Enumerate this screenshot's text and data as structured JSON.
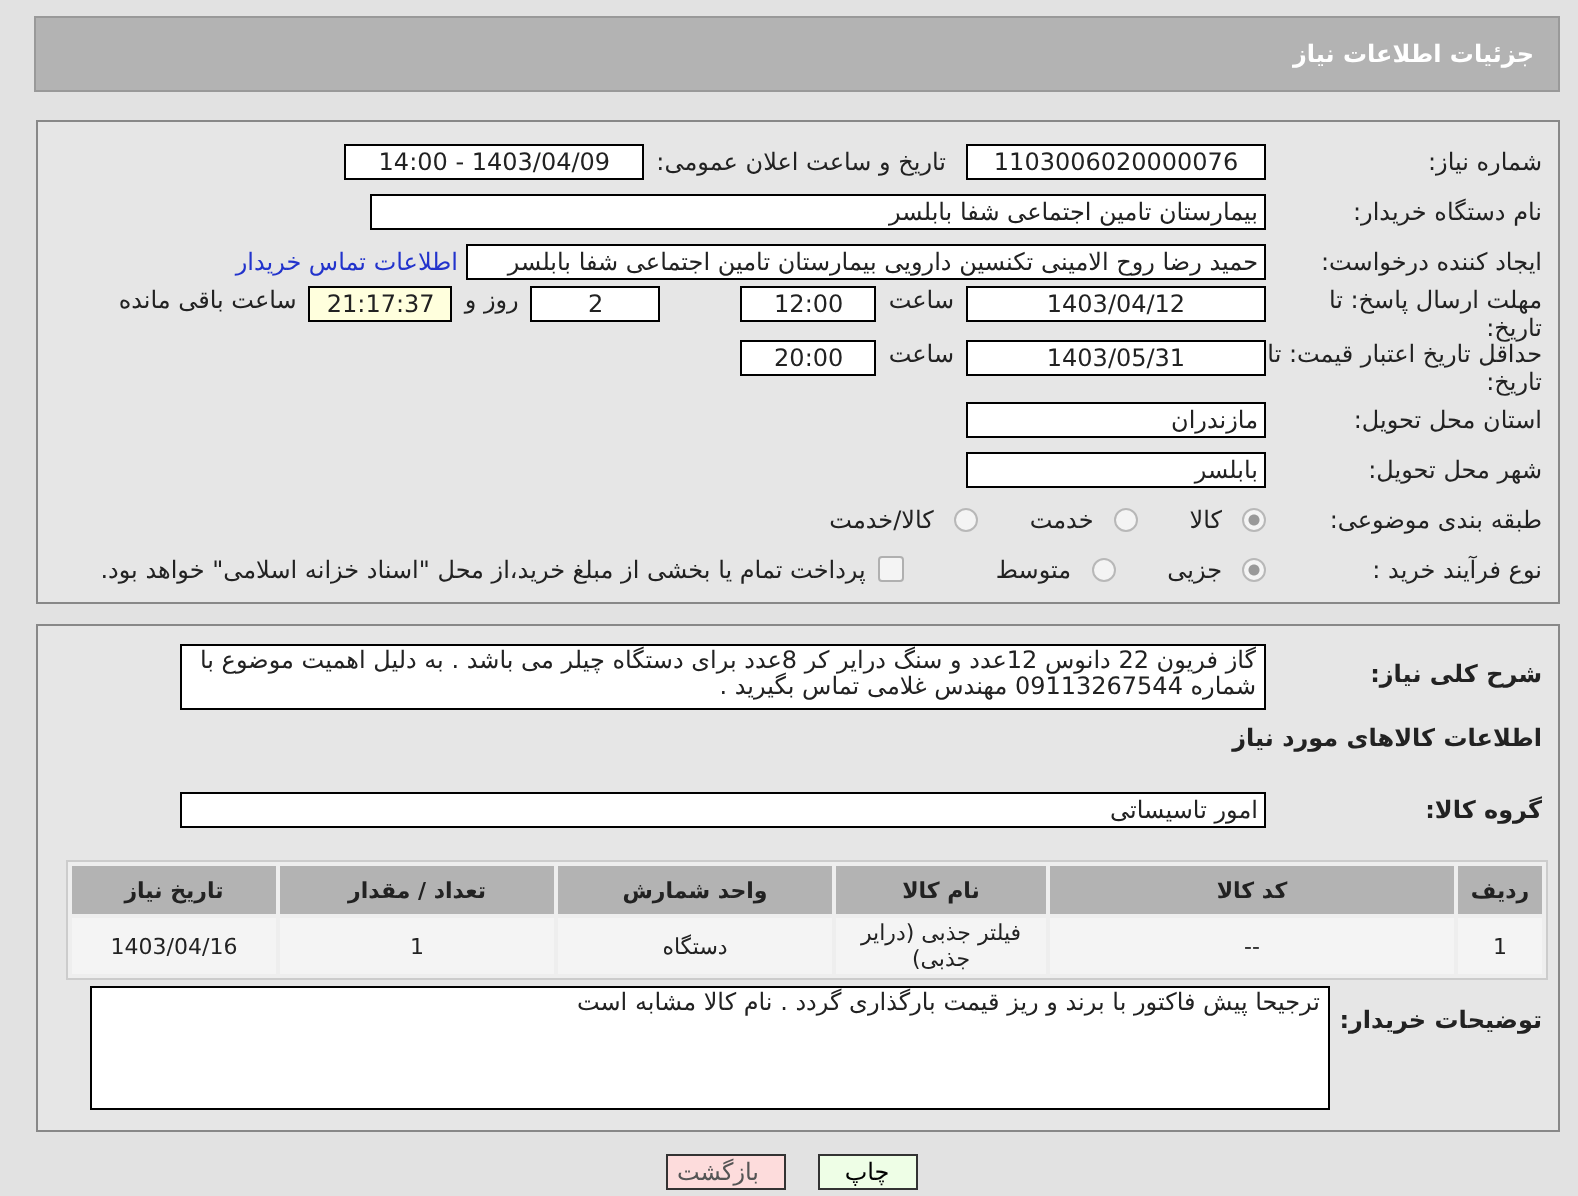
{
  "header": {
    "title": "جزئیات اطلاعات نیاز"
  },
  "need_number": {
    "label": "شماره نیاز:",
    "value": "1103006020000076"
  },
  "announce": {
    "label": "تاریخ و ساعت اعلان عمومی:",
    "value": "1403/04/09 - 14:00"
  },
  "buyer_org": {
    "label": "نام دستگاه خریدار:",
    "value": "بیمارستان تامین اجتماعی شفا بابلسر"
  },
  "requester": {
    "label": "ایجاد کننده درخواست:",
    "value": "حمید رضا روح الامینی تکنسین دارویی بیمارستان تامین اجتماعی شفا بابلسر",
    "link": "اطلاعات تماس خریدار"
  },
  "reply_deadline": {
    "label": "مهلت ارسال پاسخ: تا تاریخ:",
    "date": "1403/04/12",
    "time_label": "ساعت",
    "time": "12:00",
    "days": "2",
    "days_label": "روز و",
    "remaining": "21:17:37",
    "remaining_label": "ساعت باقی مانده"
  },
  "price_validity": {
    "label": "حداقل تاریخ اعتبار قیمت: تا تاریخ:",
    "date": "1403/05/31",
    "time_label": "ساعت",
    "time": "20:00"
  },
  "province": {
    "label": "استان محل تحویل:",
    "value": "مازندران"
  },
  "city": {
    "label": "شهر محل تحویل:",
    "value": "بابلسر"
  },
  "category": {
    "label": "طبقه بندی موضوعی:",
    "options": [
      {
        "label": "کالا",
        "selected": true
      },
      {
        "label": "خدمت",
        "selected": false
      },
      {
        "label": "کالا/خدمت",
        "selected": false
      }
    ]
  },
  "process": {
    "label": "نوع فرآیند خرید :",
    "options": [
      {
        "label": "جزیی",
        "selected": true
      },
      {
        "label": "متوسط",
        "selected": false
      }
    ],
    "payment": {
      "label": "پرداخت تمام یا بخشی از مبلغ خرید،از محل \"اسناد خزانه اسلامی\" خواهد بود.",
      "checked": false
    }
  },
  "description": {
    "label": "شرح کلی نیاز:",
    "value": "گاز فریون 22 دانوس  12عدد و سنگ درایر کر 8عدد  برای دستگاه چیلر می باشد . به دلیل اهمیت موضوع با شماره 09113267544 مهندس غلامی تماس بگیرید ."
  },
  "goods_title": "اطلاعات کالاهای مورد نیاز",
  "goods_group": {
    "label": "گروه کالا:",
    "value": "امور تاسیساتی"
  },
  "table": {
    "columns": [
      "ردیف",
      "کد کالا",
      "نام کالا",
      "واحد شمارش",
      "تعداد / مقدار",
      "تاریخ نیاز"
    ],
    "rows": [
      [
        "1",
        "--",
        "فیلتر جذبی (درایر جذبی)",
        "دستگاه",
        "1",
        "1403/04/16"
      ]
    ]
  },
  "buyer_notes": {
    "label": "توضیحات خریدار:",
    "value": "ترجیحا پیش فاکتور با برند و ریز قیمت بارگذاری گردد . نام کالا مشابه است"
  },
  "buttons": [
    {
      "label": "چاپ",
      "kind": "print"
    },
    {
      "label": "بازگشت",
      "kind": "back"
    }
  ]
}
